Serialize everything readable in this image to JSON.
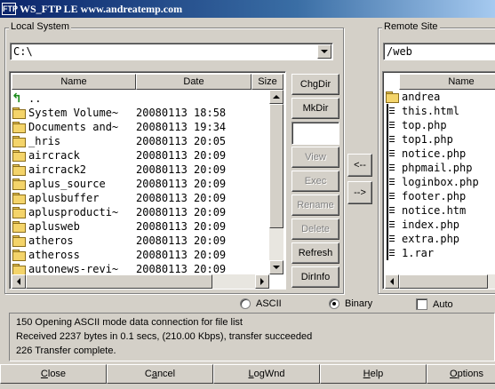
{
  "window": {
    "title": "WS_FTP LE www.andreatemp.com",
    "icon_text": "FTP"
  },
  "local": {
    "label": "Local System",
    "path": "C:\\",
    "columns": [
      "Name",
      "Date",
      "Size"
    ],
    "up_entry": "..",
    "items": [
      {
        "name": "System Volume~",
        "date": "20080113 18:58"
      },
      {
        "name": "Documents and~",
        "date": "20080113 19:34"
      },
      {
        "name": "_hris",
        "date": "20080113 20:05"
      },
      {
        "name": "aircrack",
        "date": "20080113 20:09"
      },
      {
        "name": "aircrack2",
        "date": "20080113 20:09"
      },
      {
        "name": "aplus_source",
        "date": "20080113 20:09"
      },
      {
        "name": "aplusbuffer",
        "date": "20080113 20:09"
      },
      {
        "name": "aplusproducti~",
        "date": "20080113 20:09"
      },
      {
        "name": "aplusweb",
        "date": "20080113 20:09"
      },
      {
        "name": "atheros",
        "date": "20080113 20:09"
      },
      {
        "name": "atheross",
        "date": "20080113 20:09"
      },
      {
        "name": "autonews-revi~",
        "date": "20080113 20:09"
      }
    ],
    "buttons": {
      "chgdir": "ChgDir",
      "mkdir": "MkDir",
      "view": "View",
      "exec": "Exec",
      "rename": "Rename",
      "delete": "Delete",
      "refresh": "Refresh",
      "dirinfo": "DirInfo"
    }
  },
  "transfer": {
    "download": "<--",
    "upload": "-->"
  },
  "remote": {
    "label": "Remote Site",
    "path": "/web",
    "columns": [
      "Name"
    ],
    "items": [
      {
        "name": "andrea",
        "type": "folder"
      },
      {
        "name": "this.html",
        "type": "file"
      },
      {
        "name": "top.php",
        "type": "file"
      },
      {
        "name": "top1.php",
        "type": "file"
      },
      {
        "name": "notice.php",
        "type": "file"
      },
      {
        "name": "phpmail.php",
        "type": "file"
      },
      {
        "name": "loginbox.php",
        "type": "file"
      },
      {
        "name": "footer.php",
        "type": "file"
      },
      {
        "name": "notice.htm",
        "type": "file"
      },
      {
        "name": "index.php",
        "type": "file"
      },
      {
        "name": "extra.php",
        "type": "file"
      },
      {
        "name": "1.rar",
        "type": "file"
      }
    ]
  },
  "mode": {
    "ascii": "ASCII",
    "binary": "Binary",
    "auto": "Auto",
    "selected": "binary"
  },
  "log": [
    "150 Opening ASCII mode data connection for file list",
    "Received 2237 bytes in 0.1 secs, (210.00 Kbps), transfer succeeded",
    "226 Transfer complete."
  ],
  "bottom": {
    "close": {
      "label": "Close",
      "accel": "C"
    },
    "cancel": {
      "label": "Cancel",
      "accel": "a"
    },
    "logwnd": {
      "label": "LogWnd",
      "accel": "L"
    },
    "help": {
      "label": "Help",
      "accel": "H"
    },
    "options": {
      "label": "Options",
      "accel": "O"
    }
  },
  "colors": {
    "title_start": "#0a246a",
    "title_end": "#a6caf0",
    "face": "#d4d0c8"
  }
}
